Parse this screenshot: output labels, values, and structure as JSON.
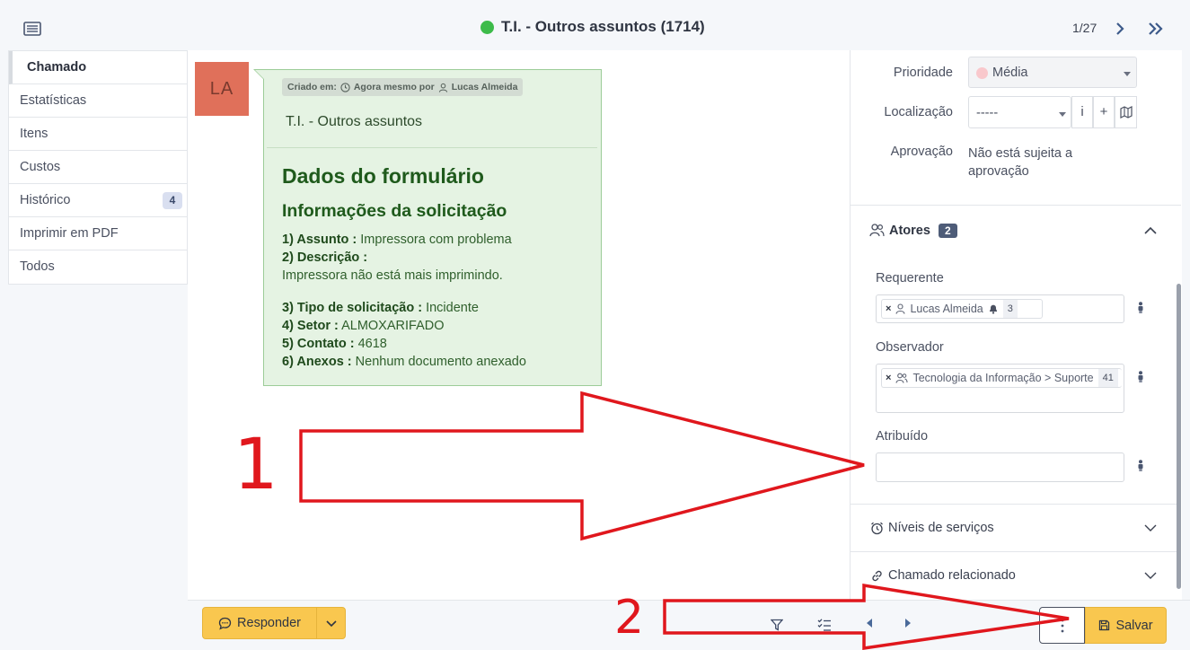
{
  "header": {
    "title": "T.I. - Outros assuntos (1714)",
    "status_color": "#3dbb4a",
    "pager": "1/27"
  },
  "menu": {
    "items": [
      {
        "label": "Chamado",
        "badge": ""
      },
      {
        "label": "Estatísticas",
        "badge": ""
      },
      {
        "label": "Itens",
        "badge": ""
      },
      {
        "label": "Custos",
        "badge": ""
      },
      {
        "label": "Histórico",
        "badge": "4"
      },
      {
        "label": "Imprimir em PDF",
        "badge": ""
      },
      {
        "label": "Todos",
        "badge": ""
      }
    ]
  },
  "ticket": {
    "avatar_initials": "LA",
    "created_label": "Criado em:",
    "created_when": "Agora mesmo por",
    "created_by": "Lucas Almeida",
    "subject": "T.I. - Outros assuntos",
    "form_title": "Dados do formulário",
    "form_subtitle": "Informações da solicitação",
    "q1_label": "1) Assunto :",
    "q1_value": "Impressora com problema",
    "q2_label": "2) Descrição :",
    "q2_value": "Impressora não está mais imprimindo.",
    "q3_label": "3) Tipo de solicitação :",
    "q3_value": "Incidente",
    "q4_label": "4) Setor :",
    "q4_value": "ALMOXARIFADO",
    "q5_label": "5) Contato :",
    "q5_value": "4618",
    "q6_label": "6) Anexos :",
    "q6_value": "Nenhum documento anexado"
  },
  "details": {
    "priority_label": "Prioridade",
    "priority_value": "Média",
    "location_label": "Localização",
    "location_value": "-----",
    "location_info_btn": "i",
    "location_add_btn": "+",
    "approval_label": "Aprovação",
    "approval_value_line1": "Não está sujeita a",
    "approval_value_line2": "aprovação"
  },
  "actors": {
    "title": "Atores",
    "count": "2",
    "requester_label": "Requerente",
    "requester_name": "Lucas Almeida",
    "requester_count": "3",
    "observer_label": "Observador",
    "observer_name": "Tecnologia da Informação > Suporte",
    "observer_count": "41",
    "assigned_label": "Atribuído",
    "remove_symbol": "×"
  },
  "sections": {
    "sla_title": "Níveis de serviços",
    "linked_title": "Chamado relacionado"
  },
  "footer": {
    "reply_label": "Responder",
    "save_label": "Salvar"
  },
  "annotations": {
    "label_1": "1",
    "label_2": "2",
    "color": "#e0171d"
  }
}
